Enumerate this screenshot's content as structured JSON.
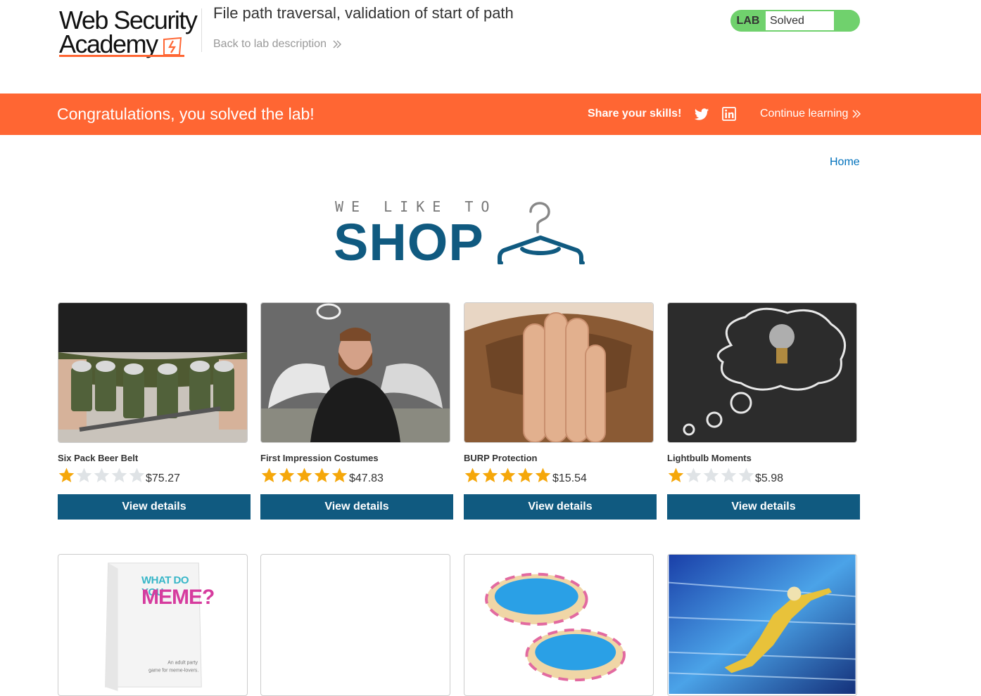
{
  "header": {
    "logo_line1": "Web Security",
    "logo_line2": "Academy",
    "lab_title": "File path traversal, validation of start of path",
    "back_link": "Back to lab description",
    "status_badge": "LAB",
    "status_text": "Solved",
    "status_color": "#70d16d"
  },
  "banner": {
    "message": "Congratulations, you solved the lab!",
    "share_label": "Share your skills!",
    "continue_label": "Continue learning",
    "background": "#ff6633"
  },
  "nav": {
    "home": "Home"
  },
  "shop_logo": {
    "top": "WE LIKE TO",
    "main": "SHOP"
  },
  "products": [
    {
      "name": "Six Pack Beer Belt",
      "price": "$75.27",
      "rating": 1,
      "button": "View details",
      "image": "beer-belt-image"
    },
    {
      "name": "First Impression Costumes",
      "price": "$47.83",
      "rating": 5,
      "button": "View details",
      "image": "angel-costume-image"
    },
    {
      "name": "BURP Protection",
      "price": "$15.54",
      "rating": 5,
      "button": "View details",
      "image": "hand-over-mouth-image"
    },
    {
      "name": "Lightbulb Moments",
      "price": "$5.98",
      "rating": 1,
      "button": "View details",
      "image": "lightbulb-chalkboard-image"
    }
  ],
  "products_row2": [
    {
      "image": "meme-card-game-image",
      "box_line1": "WHAT DO YOU",
      "box_line2": "MEME?",
      "box_caption": "An adult party game for meme-lovers."
    },
    {
      "image": "blank-product-image"
    },
    {
      "image": "paddling-pools-image"
    },
    {
      "image": "superhero-flying-image"
    }
  ],
  "colors": {
    "accent": "#ff6633",
    "primary_button": "#105a80",
    "link": "#0071bc",
    "star_filled": "#f5a70a",
    "star_empty": "#dfe3e6"
  }
}
